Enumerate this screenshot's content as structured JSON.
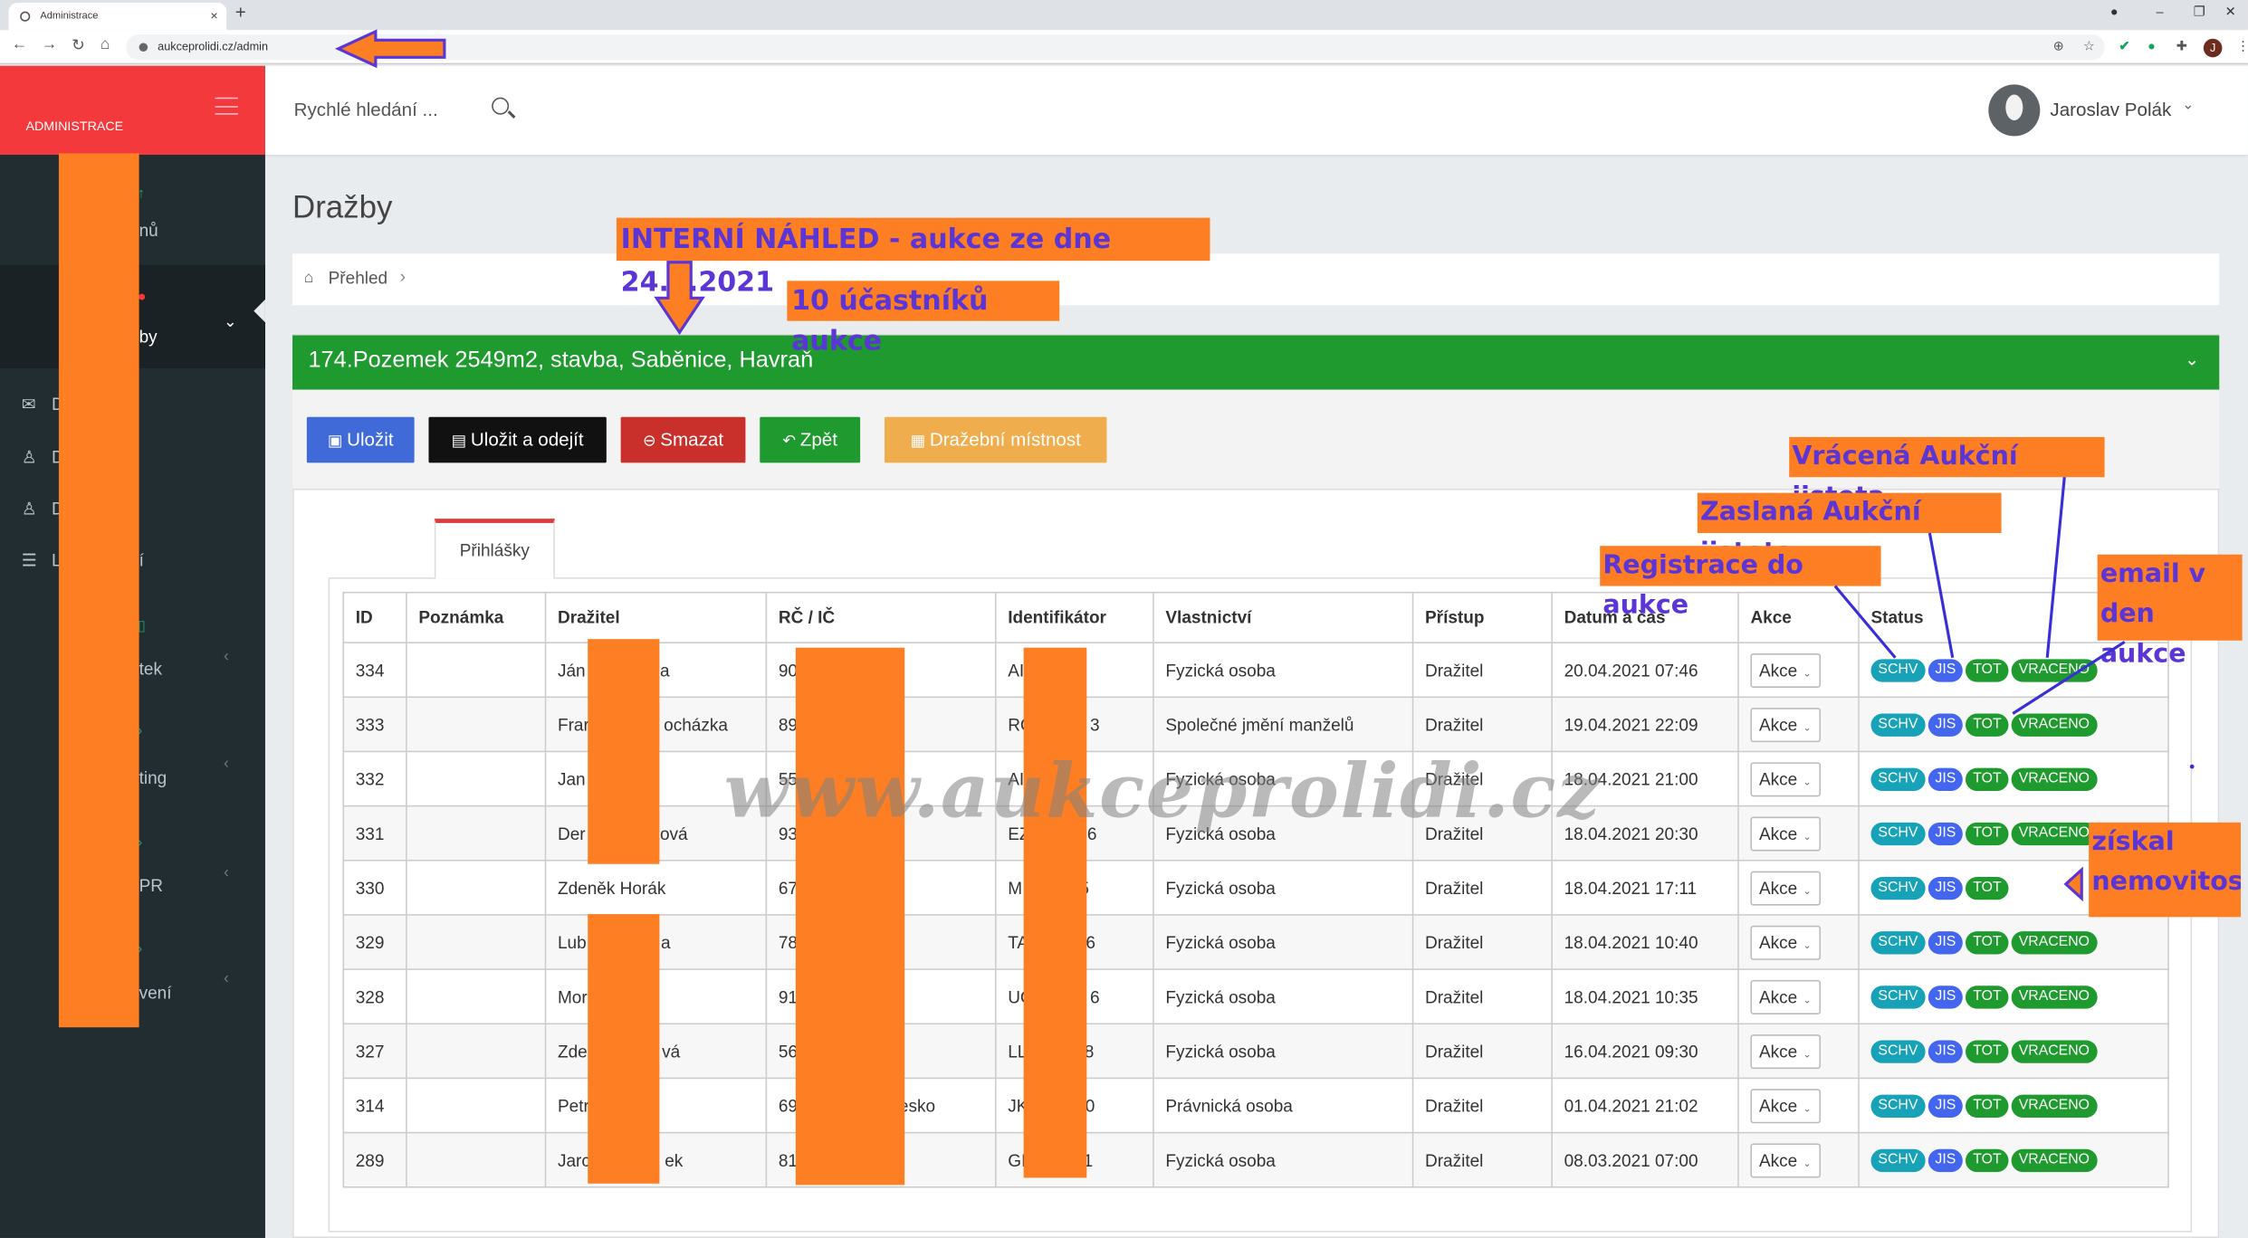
{
  "browser": {
    "tab_title": "Administrace",
    "url": "aukceprolidi.cz/admin",
    "profile_initial": "J"
  },
  "sidebar": {
    "brand": "ADMINISTRACE",
    "items": [
      {
        "label": "nů",
        "icon": "arrow-up-icon"
      },
      {
        "label": "by",
        "icon": "gavel-icon"
      },
      {
        "label": "tek",
        "icon": "file-icon"
      },
      {
        "label": "ting",
        "icon": "chart-icon"
      },
      {
        "label": "PR",
        "icon": "shield-icon"
      },
      {
        "label": "vení",
        "icon": "gear-icon"
      }
    ],
    "subitems": [
      {
        "label": "D",
        "icon": "inbox-icon"
      },
      {
        "label": "D",
        "icon": "user-icon"
      },
      {
        "label": "D",
        "icon": "user-icon"
      },
      {
        "label": "L",
        "label_end": "í",
        "icon": "list-icon"
      }
    ]
  },
  "header": {
    "quick_search": "Rychlé hledání ...",
    "user_name": "Jaroslav Polák"
  },
  "page": {
    "title": "Dražby",
    "breadcrumb": "Přehled",
    "panel_title": "174.Pozemek 2549m2, stavba, Saběnice, Havraň",
    "buttons": {
      "save": "Uložit",
      "save_leave": "Uložit a odejít",
      "delete": "Smazat",
      "back": "Zpět",
      "room": "Dražební místnost"
    },
    "tab": "Přihlášky"
  },
  "table": {
    "headers": [
      "ID",
      "Poznámka",
      "Dražitel",
      "RČ / IČ",
      "Identifikátor",
      "Vlastnictví",
      "Přístup",
      "Datum a čas",
      "Akce",
      "Status"
    ],
    "action_label": "Akce",
    "rows": [
      {
        "id": "334",
        "note": "",
        "bidder": "Ján",
        "bidder_end": "a",
        "rc": "90",
        "rc_end": "",
        "ident": "AI",
        "ident_end": "",
        "own": "Fyzická osoba",
        "access": "Dražitel",
        "date": "20.04.2021 07:46",
        "status": [
          "SCHV",
          "JIS",
          "TOT",
          "VRACENO"
        ]
      },
      {
        "id": "333",
        "note": "",
        "bidder": "Frar",
        "bidder_end": "ocházka",
        "rc": "89",
        "rc_end": "",
        "ident": "RC",
        "ident_end": "3",
        "own": "Společné jmění manželů",
        "access": "Dražitel",
        "date": "19.04.2021 22:09",
        "status": [
          "SCHV",
          "JIS",
          "TOT",
          "VRACENO"
        ]
      },
      {
        "id": "332",
        "note": "",
        "bidder": "Jan",
        "bidder_end": "",
        "rc": "55",
        "rc_end": "",
        "ident": "AI",
        "ident_end": "",
        "own": "Fyzická osoba",
        "access": "Dražitel",
        "date": "18.04.2021 21:00",
        "status": [
          "SCHV",
          "JIS",
          "TOT",
          "VRACENO"
        ]
      },
      {
        "id": "331",
        "note": "",
        "bidder": "Der",
        "bidder_end": "ová",
        "rc": "93",
        "rc_end": "",
        "ident": "EZ",
        "ident_end": "6",
        "own": "Fyzická osoba",
        "access": "Dražitel",
        "date": "18.04.2021 20:30",
        "status": [
          "SCHV",
          "JIS",
          "TOT",
          "VRACENO"
        ]
      },
      {
        "id": "330",
        "note": "",
        "bidder": "Zdeněk Horák",
        "bidder_end": "",
        "rc": "67",
        "rc_end": "",
        "ident": "M",
        "ident_end": "5",
        "own": "Fyzická osoba",
        "access": "Dražitel",
        "date": "18.04.2021 17:11",
        "status": [
          "SCHV",
          "JIS",
          "TOT"
        ]
      },
      {
        "id": "329",
        "note": "",
        "bidder": "Lub",
        "bidder_end": "a",
        "rc": "78",
        "rc_end": "",
        "ident": "TA",
        "ident_end": "6",
        "own": "Fyzická osoba",
        "access": "Dražitel",
        "date": "18.04.2021 10:40",
        "status": [
          "SCHV",
          "JIS",
          "TOT",
          "VRACENO"
        ]
      },
      {
        "id": "328",
        "note": "",
        "bidder": "Mor",
        "bidder_end": "",
        "rc": "91",
        "rc_end": "",
        "ident": "UC",
        "ident_end": "6",
        "own": "Fyzická osoba",
        "access": "Dražitel",
        "date": "18.04.2021 10:35",
        "status": [
          "SCHV",
          "JIS",
          "TOT",
          "VRACENO"
        ]
      },
      {
        "id": "327",
        "note": "",
        "bidder": "Zde",
        "bidder_end": "vá",
        "rc": "56",
        "rc_end": "",
        "ident": "LL",
        "ident_end": "8",
        "own": "Fyzická osoba",
        "access": "Dražitel",
        "date": "16.04.2021 09:30",
        "status": [
          "SCHV",
          "JIS",
          "TOT",
          "VRACENO"
        ]
      },
      {
        "id": "314",
        "note": "",
        "bidder": "Petr",
        "bidder_end": "",
        "rc": "69",
        "rc_end": "Česko",
        "ident": "JK",
        "ident_end": "0",
        "own": "Právnická osoba",
        "access": "Dražitel",
        "date": "01.04.2021 21:02",
        "status": [
          "SCHV",
          "JIS",
          "TOT",
          "VRACENO"
        ]
      },
      {
        "id": "289",
        "note": "",
        "bidder": "Jarc",
        "bidder_end": "ek",
        "rc": "81",
        "rc_end": "",
        "ident": "GI",
        "ident_end": "1",
        "own": "Fyzická osoba",
        "access": "Dražitel",
        "date": "08.03.2021 07:00",
        "status": [
          "SCHV",
          "JIS",
          "TOT",
          "VRACENO"
        ]
      }
    ]
  },
  "annotations": {
    "internal": "INTERNÍ NÁHLED - aukce ze dne 24.4.2021",
    "participants": "10 účastníků aukce",
    "returned": "Vrácená Aukční jistota",
    "sent": "Zaslaná Aukční jistota",
    "registration": "Registrace do aukce",
    "email_1": "email v",
    "email_2": "den aukce",
    "won_1": "získal",
    "won_2": "nemovitost",
    "watermark": "www.aukceprolidi.cz"
  },
  "colors": {
    "brand_red": "#f3393b",
    "sidebar": "#222d32",
    "panel_green": "#1e9a2e",
    "btn_blue": "#3f6ad8",
    "btn_black": "#111111",
    "btn_red": "#c9302c",
    "btn_green": "#1e9a2e",
    "btn_orange": "#f0ad4e",
    "annotation": "#fd7e23"
  }
}
